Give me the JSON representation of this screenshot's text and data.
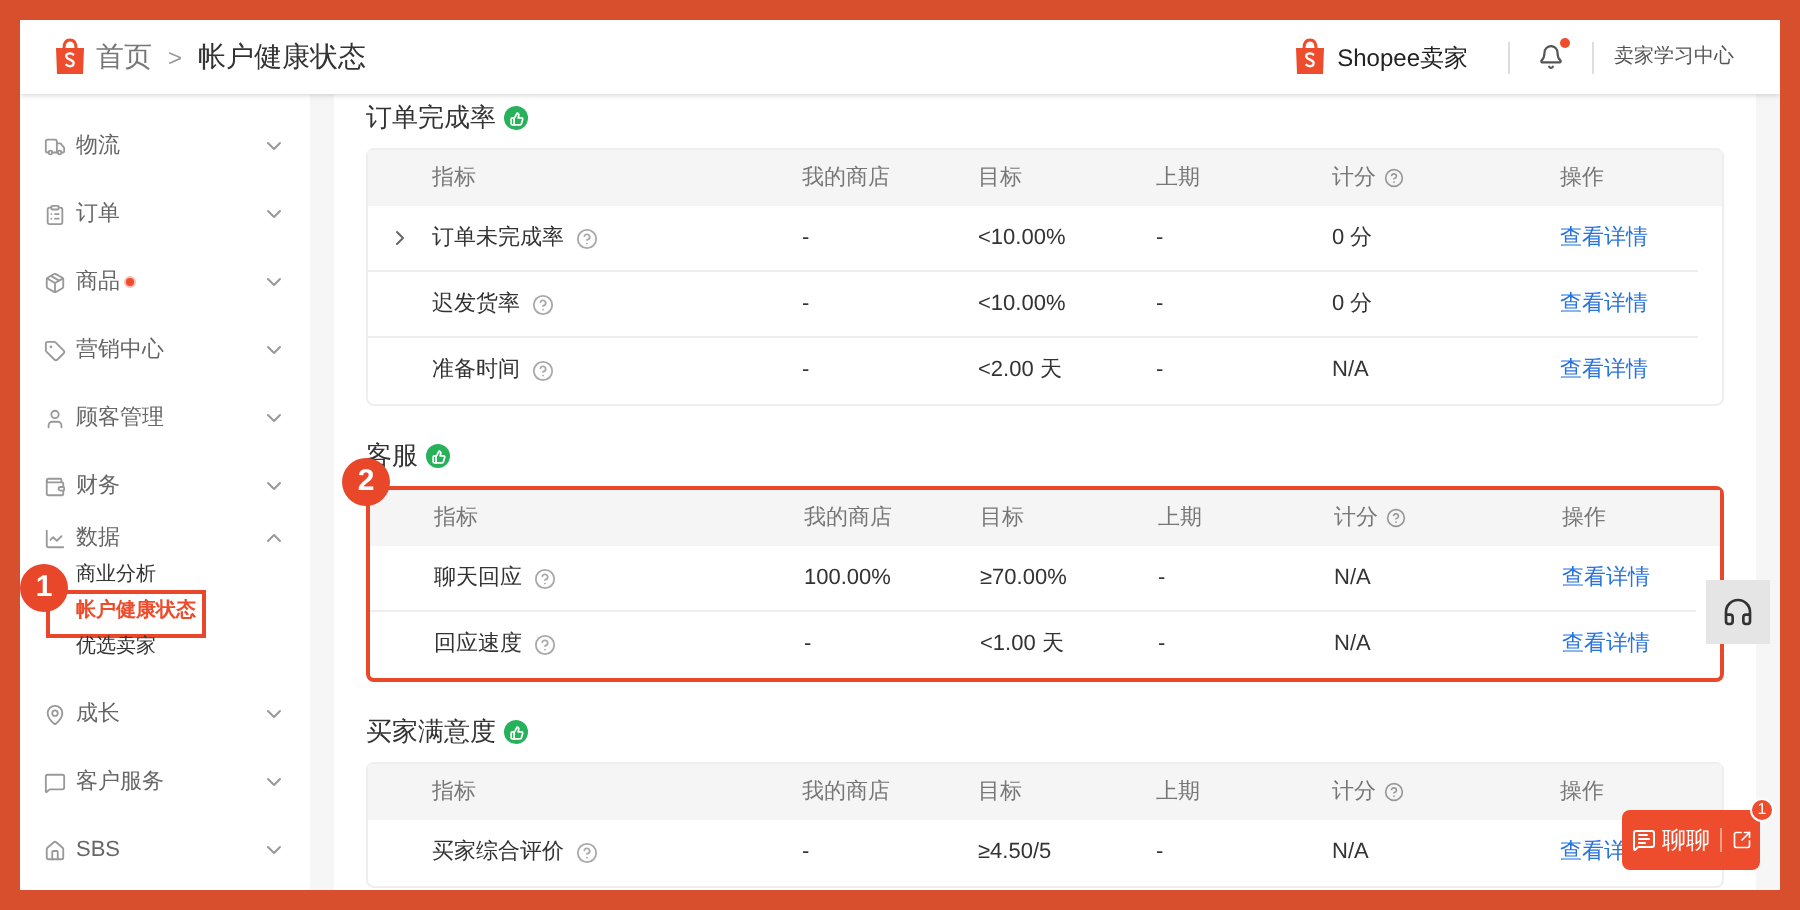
{
  "header": {
    "breadcrumb": [
      "首页",
      "帐户健康状态"
    ],
    "separator": ">",
    "brand": "Shopee卖家",
    "notification_dot": true,
    "learning_center": "卖家学习中心"
  },
  "sidebar": {
    "items": [
      {
        "label": "物流",
        "expanded": false,
        "dot": false
      },
      {
        "label": "订单",
        "expanded": false,
        "dot": false
      },
      {
        "label": "商品",
        "expanded": false,
        "dot": true
      },
      {
        "label": "营销中心",
        "expanded": false,
        "dot": false
      },
      {
        "label": "顾客管理",
        "expanded": false,
        "dot": false
      },
      {
        "label": "财务",
        "expanded": false,
        "dot": false
      },
      {
        "label": "数据",
        "expanded": true,
        "dot": false,
        "children": [
          {
            "label": "商业分析",
            "selected": false
          },
          {
            "label": "帐户健康状态",
            "selected": true,
            "annotation": "1"
          },
          {
            "label": "优选卖家",
            "selected": false
          }
        ]
      },
      {
        "label": "成长",
        "expanded": false,
        "dot": false
      },
      {
        "label": "客户服务",
        "expanded": false,
        "dot": false
      },
      {
        "label": "SBS",
        "expanded": false,
        "dot": false
      }
    ]
  },
  "sections": [
    {
      "title": "订单完成率",
      "columns": [
        {
          "label": "指标",
          "help": false
        },
        {
          "label": "我的商店",
          "help": false
        },
        {
          "label": "目标",
          "help": false
        },
        {
          "label": "上期",
          "help": false
        },
        {
          "label": "计分",
          "help": true
        },
        {
          "label": "操作",
          "help": false
        }
      ],
      "rows": [
        {
          "expandable": true,
          "cells": [
            "订单未完成率",
            "-",
            "<10.00%",
            "-",
            "0 分"
          ],
          "action": "查看详情"
        },
        {
          "expandable": false,
          "cells": [
            "迟发货率",
            "-",
            "<10.00%",
            "-",
            "0 分"
          ],
          "action": "查看详情"
        },
        {
          "expandable": false,
          "cells": [
            "准备时间",
            "-",
            "<2.00 天",
            "-",
            "N/A"
          ],
          "action": "查看详情"
        }
      ]
    },
    {
      "title": "客服",
      "annotation": "2",
      "columns": [
        {
          "label": "指标",
          "help": false
        },
        {
          "label": "我的商店",
          "help": false
        },
        {
          "label": "目标",
          "help": false
        },
        {
          "label": "上期",
          "help": false
        },
        {
          "label": "计分",
          "help": true
        },
        {
          "label": "操作",
          "help": false
        }
      ],
      "rows": [
        {
          "expandable": false,
          "cells": [
            "聊天回应",
            "100.00%",
            "≥70.00%",
            "-",
            "N/A"
          ],
          "action": "查看详情"
        },
        {
          "expandable": false,
          "cells": [
            "回应速度",
            "-",
            "<1.00 天",
            "-",
            "N/A"
          ],
          "action": "查看详情"
        }
      ]
    },
    {
      "title": "买家满意度",
      "columns": [
        {
          "label": "指标",
          "help": false
        },
        {
          "label": "我的商店",
          "help": false
        },
        {
          "label": "目标",
          "help": false
        },
        {
          "label": "上期",
          "help": false
        },
        {
          "label": "计分",
          "help": true
        },
        {
          "label": "操作",
          "help": false
        }
      ],
      "rows": [
        {
          "expandable": false,
          "cells": [
            "买家综合评价",
            "-",
            "≥4.50/5",
            "-",
            "N/A"
          ],
          "action": "查看详"
        }
      ]
    }
  ],
  "chat": {
    "label": "聊聊",
    "badge": "1"
  }
}
